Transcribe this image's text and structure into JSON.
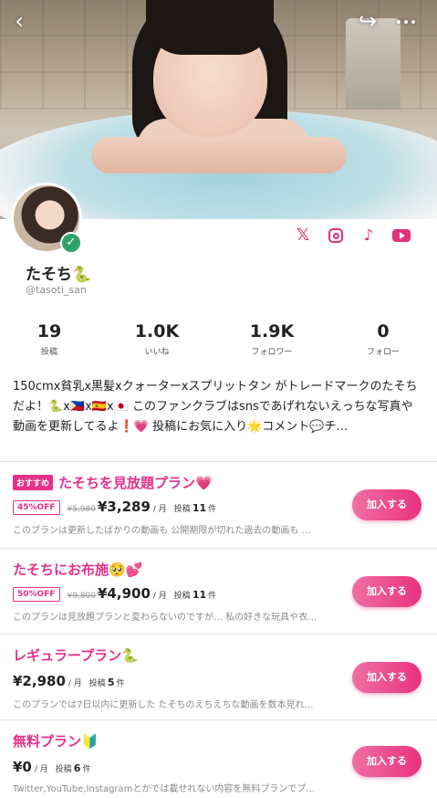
{
  "profile": {
    "display_name": "たそち🐍",
    "handle": "@tasoti_san",
    "verified": true
  },
  "nav": {
    "back_icon": "back-arrow-icon",
    "share_icon": "share-icon",
    "more_icon": "more-dots-icon"
  },
  "social": [
    {
      "name": "x-icon",
      "glyph": "𝕏"
    },
    {
      "name": "instagram-icon",
      "glyph": ""
    },
    {
      "name": "tiktok-icon",
      "glyph": "♪"
    },
    {
      "name": "youtube-icon",
      "glyph": ""
    }
  ],
  "stats": [
    {
      "value": "19",
      "label": "投稿"
    },
    {
      "value": "1.0K",
      "label": "いいね"
    },
    {
      "value": "1.9K",
      "label": "フォロワー"
    },
    {
      "value": "0",
      "label": "フォロー"
    }
  ],
  "bio": "150cmx貧乳x黒髪xクォーターxスプリットタン がトレードマークのたそちだよ！🐍x🇵🇭x🇪🇸x🇯🇵 このファンクラブはsnsであげれないえっちな写真や動画を更新してるよ❗️💗 投稿にお気に入り🌟コメント💬チ…",
  "plans": [
    {
      "badge": "おすすめ",
      "title": "たそちを見放題プラン💗",
      "discount": "45%OFF",
      "original_price": "¥5,980",
      "price": "¥3,289",
      "per_month": "/ 月",
      "posts_label": "投稿",
      "posts_count": "11",
      "posts_unit": "件",
      "description": "このプランは更新したばかりの動画も 公開期限が切れた過去の動画も …",
      "button": "加入する"
    },
    {
      "title": "たそちにお布施🥺💕",
      "discount": "50%OFF",
      "original_price": "¥9,800",
      "price": "¥4,900",
      "per_month": "/ 月",
      "posts_label": "投稿",
      "posts_count": "11",
      "posts_unit": "件",
      "description": "このプランは見放題プランと変わらないのですが… 私の好きな玩具や衣…",
      "button": "加入する"
    },
    {
      "title": "レギュラープラン🐍",
      "price": "¥2,980",
      "per_month": "/ 月",
      "posts_label": "投稿",
      "posts_count": "5",
      "posts_unit": "件",
      "description": "このプランでは7日以内に更新した たそちのえちえちな動画を数本見れ…",
      "button": "加入する"
    },
    {
      "title": "無料プラン🔰",
      "price": "¥0",
      "per_month": "/ 月",
      "posts_label": "投稿",
      "posts_count": "6",
      "posts_unit": "件",
      "description": "Twitter,YouTube,Instagramとかでは載せれない内容を無料プランでプ…",
      "button": "加入する"
    }
  ],
  "colors": {
    "accent": "#e4318a",
    "verified": "#2fa36b"
  }
}
